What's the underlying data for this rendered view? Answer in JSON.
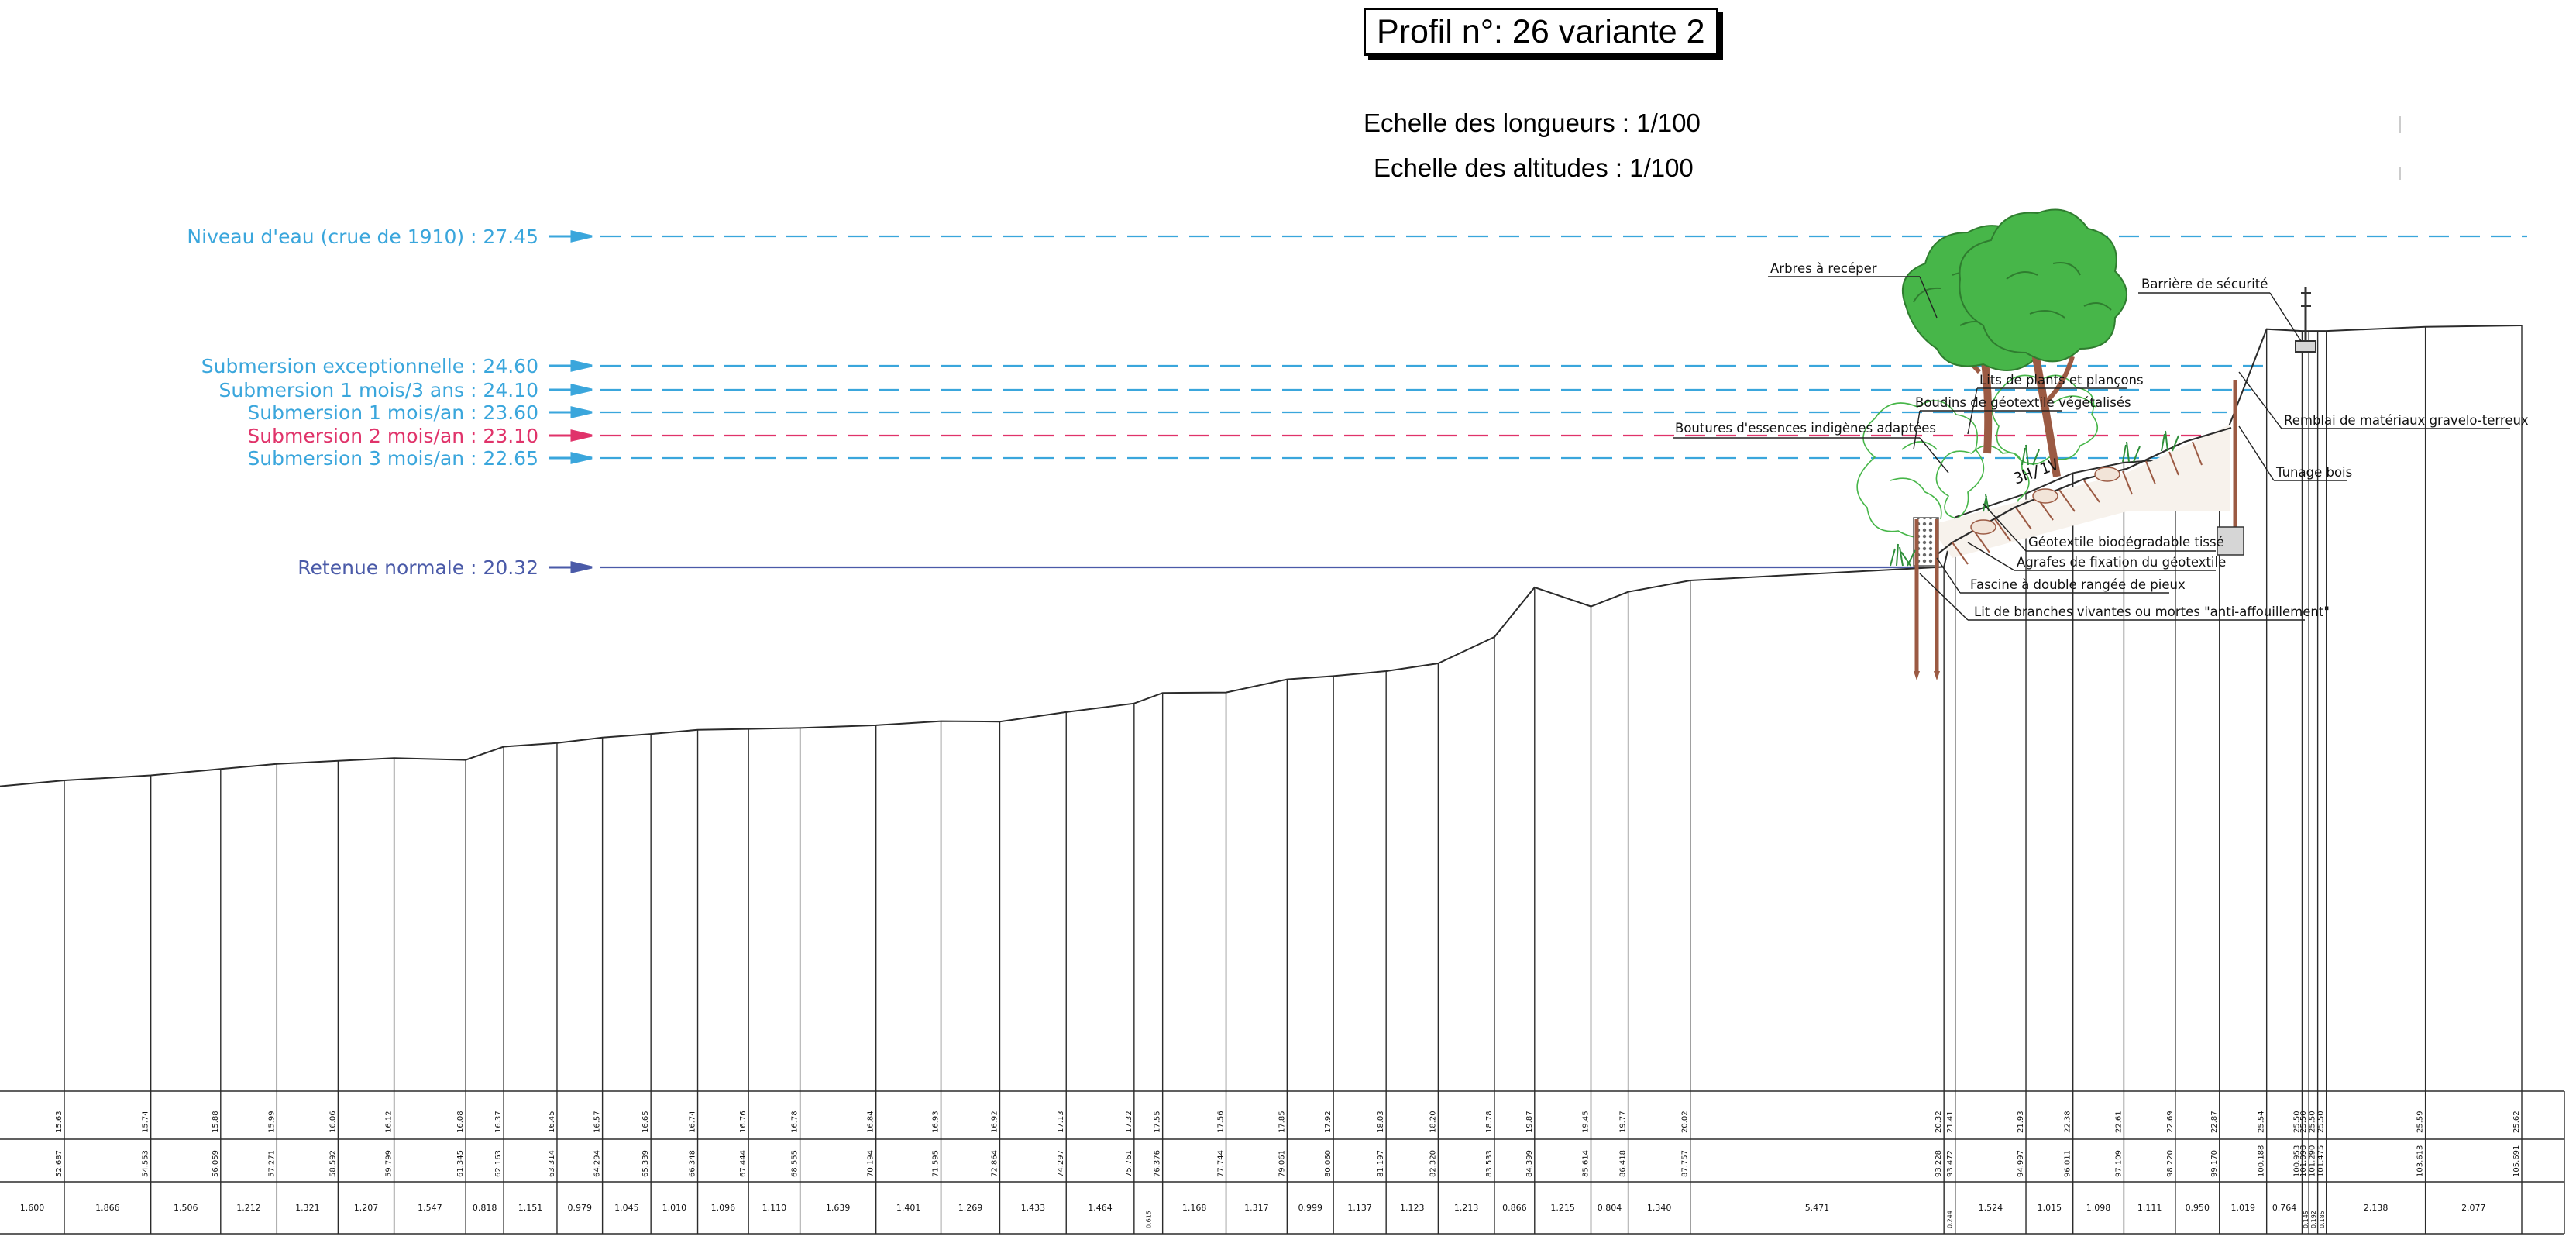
{
  "title": "Profil n°: 26 variante 2",
  "scale_lengths": "Echelle des longueurs : 1/100",
  "scale_altitudes": "Echelle des altitudes : 1/100",
  "colors": {
    "water": "#3aa6dc",
    "alert": "#e0336a",
    "retenue": "#4a5aa8",
    "tree": "#47b649",
    "trunk": "#9b5a43",
    "ground": "#2b2b2b"
  },
  "water_levels": [
    {
      "label": "Niveau d'eau (crue de 1910) : 27.45",
      "kind": "normal"
    },
    {
      "label": "Submersion exceptionnelle : 24.60",
      "kind": "normal"
    },
    {
      "label": "Submersion 1 mois/3 ans : 24.10",
      "kind": "normal"
    },
    {
      "label": "Submersion 1 mois/an : 23.60",
      "kind": "normal"
    },
    {
      "label": "Submersion 2 mois/an : 23.10",
      "kind": "alert"
    },
    {
      "label": "Submersion 3 mois/an : 22.65",
      "kind": "normal"
    },
    {
      "label": "Retenue normale : 20.32",
      "kind": "retenue"
    }
  ],
  "annotations": [
    "Arbres à recéper",
    "Barrière de sécurité",
    "Lits de plants et plançons",
    "Boudins de géotextile végétalisés",
    "Boutures d'essences indigènes adaptées",
    "Remblai de matériaux gravelo-terreux",
    "Tunage bois",
    "Géotextile biodégradable tissé",
    "Agrafes de fixation du géotextile",
    "Fascine à double rangée de pieux",
    "Lit de branches vivantes ou mortes \"anti-affouillement\""
  ],
  "slope_label": "3H/1V",
  "altitudes": [
    "15.63",
    "15.74",
    "15.88",
    "15.99",
    "16.06",
    "16.12",
    "16.08",
    "16.37",
    "16.45",
    "16.57",
    "16.65",
    "16.74",
    "16.76",
    "16.78",
    "16.84",
    "16.93",
    "16.92",
    "17.13",
    "17.32",
    "17.55",
    "17.56",
    "17.85",
    "17.92",
    "18.03",
    "18.20",
    "18.78",
    "19.87",
    "19.45",
    "19.77",
    "20.02",
    "20.32",
    "21.41",
    "21.93",
    "22.38",
    "22.61",
    "22.69",
    "22.87",
    "25.54",
    "25.50",
    "25.50",
    "25.50",
    "25.50",
    "25.59",
    "25.62"
  ],
  "distances": [
    "52.687",
    "54.553",
    "56.059",
    "57.271",
    "58.592",
    "59.799",
    "61.345",
    "62.163",
    "63.314",
    "64.294",
    "65.339",
    "66.348",
    "67.444",
    "68.555",
    "70.194",
    "71.595",
    "72.864",
    "74.297",
    "75.761",
    "76.376",
    "77.744",
    "79.061",
    "80.060",
    "81.197",
    "82.320",
    "83.533",
    "84.399",
    "85.614",
    "86.418",
    "87.757",
    "93.228",
    "93.472",
    "94.997",
    "96.011",
    "97.109",
    "98.220",
    "99.170",
    "100.188",
    "100.953",
    "101.098",
    "101.290",
    "101.475",
    "103.613",
    "105.691"
  ],
  "partials": [
    "1.600",
    "1.866",
    "1.506",
    "1.212",
    "1.321",
    "1.207",
    "1.547",
    "0.818",
    "1.151",
    "0.979",
    "1.045",
    "1.010",
    "1.096",
    "1.110",
    "1.639",
    "1.401",
    "1.269",
    "1.433",
    "1.464",
    "0.615",
    "1.168",
    "1.317",
    "0.999",
    "1.137",
    "1.123",
    "1.213",
    "0.866",
    "1.215",
    "0.804",
    "1.340",
    "5.471",
    "0.244",
    "1.524",
    "1.015",
    "1.098",
    "1.111",
    "0.950",
    "1.019",
    "0.764",
    "0.145",
    "0.192",
    "0.185",
    "2.138",
    "2.077"
  ]
}
